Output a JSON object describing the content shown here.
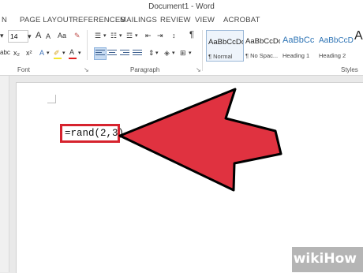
{
  "window": {
    "title": "Document1 - Word"
  },
  "tabs": [
    "N",
    "PAGE LAYOUT",
    "REFERENCES",
    "MAILINGS",
    "REVIEW",
    "VIEW",
    "ACROBAT"
  ],
  "font": {
    "size_value": "14",
    "group_label": "Font",
    "buttons": [
      "A",
      "A",
      "Aa",
      "x₂",
      "x²",
      "A",
      "A"
    ]
  },
  "paragraph": {
    "group_label": "Paragraph",
    "pilcrow": "¶"
  },
  "styles": {
    "group_label": "Styles",
    "items": [
      {
        "preview": "AaBbCcDc",
        "name": "¶ Normal"
      },
      {
        "preview": "AaBbCcDc",
        "name": "¶ No Spac..."
      },
      {
        "preview": "AaBbCc",
        "name": "Heading 1"
      },
      {
        "preview": "AaBbCcD",
        "name": "Heading 2"
      }
    ],
    "more": "A"
  },
  "document": {
    "formula": "=rand(2,3)"
  },
  "annotation": {
    "arrow_color": "#e03240",
    "box_color": "#d6232e"
  },
  "watermark": {
    "text": "wikiHow"
  }
}
